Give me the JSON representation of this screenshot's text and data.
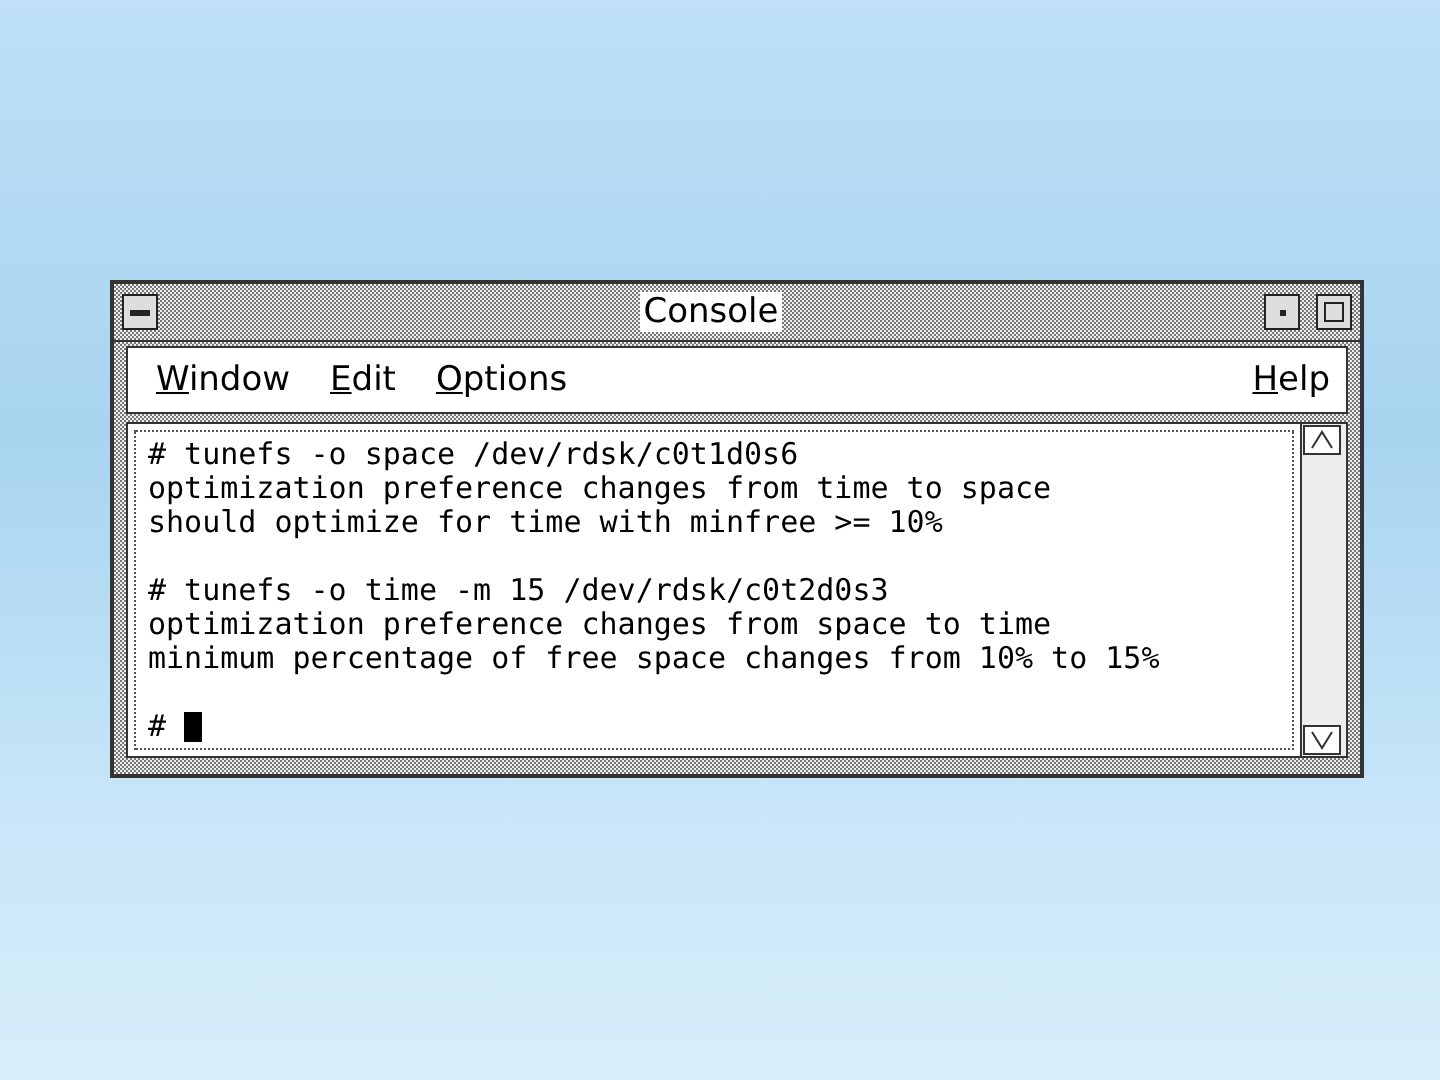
{
  "window": {
    "title": "Console"
  },
  "menu": {
    "left": [
      "Window",
      "Edit",
      "Options"
    ],
    "right": [
      "Help"
    ]
  },
  "terminal": {
    "blocks": [
      {
        "lines": [
          "# tunefs -o space /dev/rdsk/c0t1d0s6",
          "optimization preference changes from time to space",
          "should optimize for time with minfree >= 10%"
        ]
      },
      {
        "lines": [
          "# tunefs -o time -m 15 /dev/rdsk/c0t2d0s3",
          "optimization preference changes from space to time",
          "minimum percentage of free space changes from 10% to 15%"
        ]
      }
    ],
    "prompt": {
      "text": "#",
      "cursor": true
    }
  }
}
